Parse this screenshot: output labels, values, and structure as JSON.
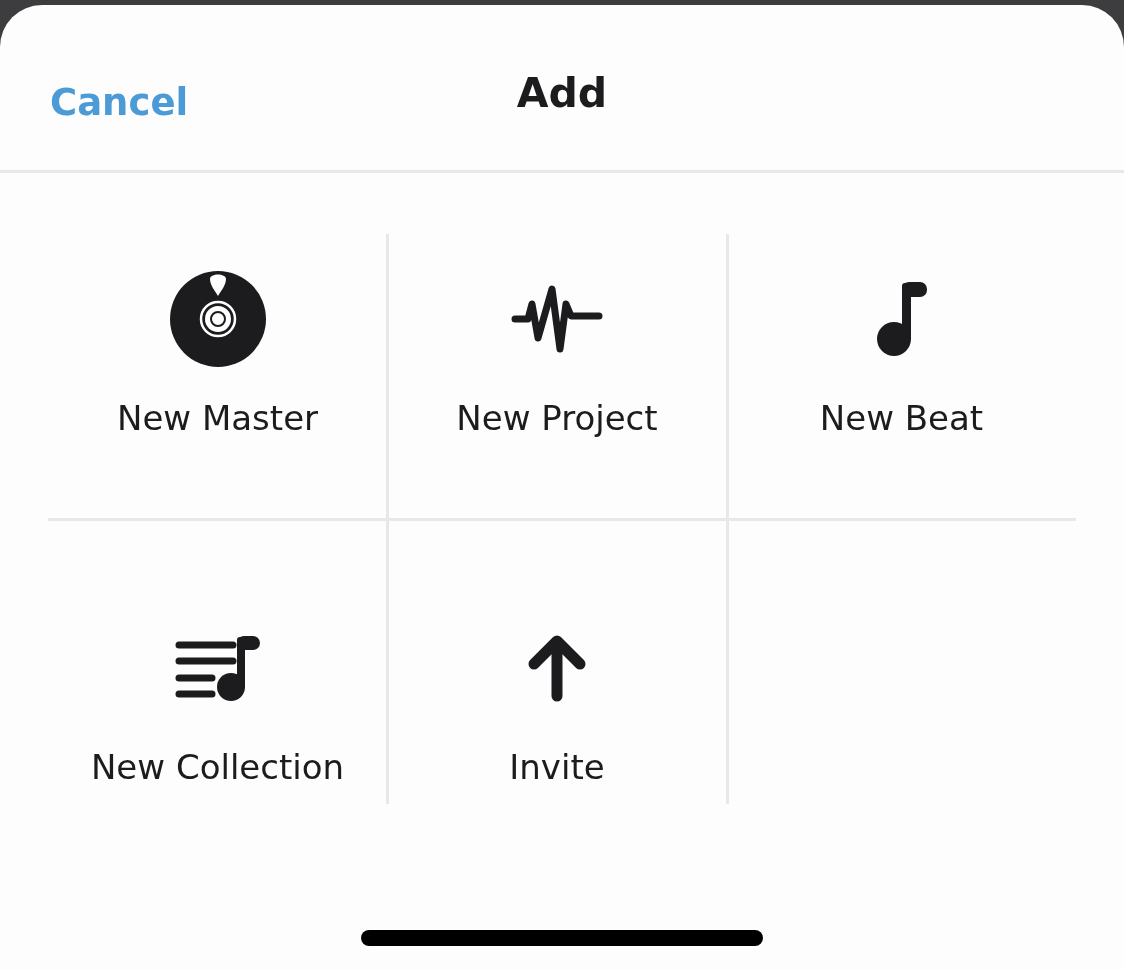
{
  "header": {
    "cancel": "Cancel",
    "title": "Add"
  },
  "actions": [
    {
      "kind": "master",
      "label": "New Master"
    },
    {
      "kind": "project",
      "label": "New Project"
    },
    {
      "kind": "beat",
      "label": "New Beat"
    },
    {
      "kind": "collection",
      "label": "New Collection"
    },
    {
      "kind": "invite",
      "label": "Invite"
    }
  ]
}
